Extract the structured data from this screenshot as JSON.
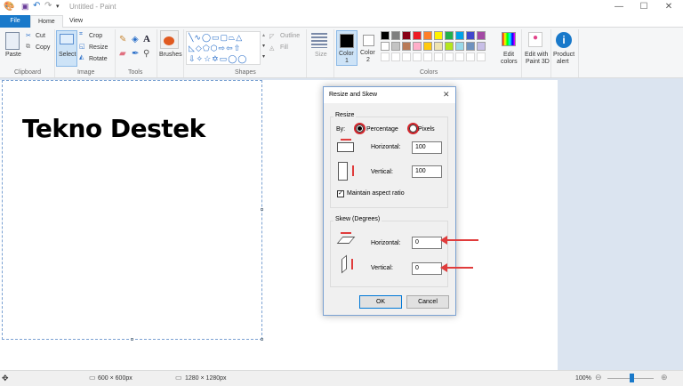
{
  "title": "Untitled - Paint",
  "tabs": {
    "file": "File",
    "home": "Home",
    "view": "View"
  },
  "ribbon": {
    "clipboard": {
      "group": "Clipboard",
      "paste": "Paste",
      "cut": "Cut",
      "copy": "Copy"
    },
    "image": {
      "group": "Image",
      "select": "Select",
      "crop": "Crop",
      "resize": "Resize",
      "rotate": "Rotate"
    },
    "tools": {
      "group": "Tools"
    },
    "brushes": "Brushes",
    "shapes": {
      "group": "Shapes",
      "outline": "Outline",
      "fill": "Fill"
    },
    "size": "Size",
    "colors": {
      "group": "Colors",
      "color1": "Color",
      "color1_n": "1",
      "color2": "Color",
      "color2_n": "2",
      "edit_colors_1": "Edit",
      "edit_colors_2": "colors",
      "palette_row1": [
        "#000000",
        "#7f7f7f",
        "#880015",
        "#ed1c24",
        "#ff7f27",
        "#fff200",
        "#22b14c",
        "#00a2e8",
        "#3f48cc",
        "#a349a4"
      ],
      "palette_row2": [
        "#ffffff",
        "#c3c3c3",
        "#b97a57",
        "#ffaec9",
        "#ffc90e",
        "#efe4b0",
        "#b5e61d",
        "#99d9ea",
        "#7092be",
        "#c8bfe7"
      ]
    },
    "paint3d_1": "Edit with",
    "paint3d_2": "Paint 3D",
    "alert_1": "Product",
    "alert_2": "alert"
  },
  "canvas_text": "Tekno Destek",
  "dialog": {
    "title": "Resize and Skew",
    "resize_legend": "Resize",
    "by": "By:",
    "percentage": "Percentage",
    "pixels": "Pixels",
    "horizontal": "Horizontal:",
    "vertical": "Vertical:",
    "h_value": "100",
    "v_value": "100",
    "maintain": "Maintain aspect ratio",
    "skew_legend": "Skew (Degrees)",
    "skew_h": "Horizontal:",
    "skew_v": "Vertical:",
    "skew_h_value": "0",
    "skew_v_value": "0",
    "ok": "OK",
    "cancel": "Cancel"
  },
  "status": {
    "selection": "600 × 600px",
    "image": "1280 × 1280px",
    "zoom": "100%"
  }
}
